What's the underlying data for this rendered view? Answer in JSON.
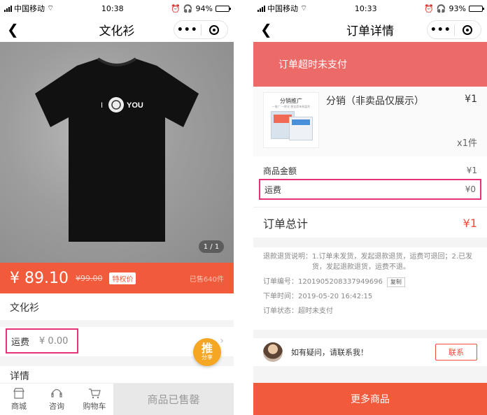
{
  "left": {
    "status": {
      "carrier": "中国移动",
      "time": "10:38",
      "battery": "94%",
      "battery_level": 0.94
    },
    "nav": {
      "title": "文化衫"
    },
    "hero": {
      "page_indicator": "1 / 1",
      "shirt_text_left": "I",
      "shirt_text_right": "YOU"
    },
    "price": {
      "current": "¥ 89.10",
      "original": "¥99.00",
      "tag": "特权价",
      "sold": "已售640件"
    },
    "name": "文化衫",
    "shipping": {
      "label": "运费",
      "value": "¥ 0.00"
    },
    "details_label": "详情",
    "promote": {
      "big": "推",
      "small": "分享"
    },
    "bottom": {
      "store": "商城",
      "consult": "咨询",
      "cart": "购物车",
      "status_button": "商品已售罄"
    }
  },
  "right": {
    "status": {
      "carrier": "中国移动",
      "time": "10:33",
      "battery": "93%",
      "battery_level": 0.93
    },
    "nav": {
      "title": "订单详情"
    },
    "alert": "订单超时未支付",
    "product": {
      "thumb_title": "分销推广",
      "thumb_subtitle": "一推广 一转化 便宜简单易盈利",
      "name": "分销（非卖品仅展示）",
      "price": "¥1",
      "qty": "x1件"
    },
    "amount": {
      "label": "商品金额",
      "value": "¥1"
    },
    "shipping": {
      "label": "运费",
      "value": "¥0"
    },
    "total": {
      "label": "订单总计",
      "value": "¥1"
    },
    "info": {
      "refund_label": "退款退货说明：",
      "refund_text": "1.订单未发货，发起退款退货，运费可退回；2.已发货，发起退款退货，运费不退。",
      "order_no": "订单编号：1201905208337949696",
      "copy": "复制",
      "order_time": "下单时间：2019-05-20 16:42:15",
      "order_status": "订单状态：超时未支付"
    },
    "contact": {
      "question": "如有疑问，请联系我！",
      "button": "联系"
    },
    "more_button": "更多商品"
  },
  "colors": {
    "accent": "#f15a3b",
    "alert": "#ec6a67",
    "highlight": "#e9317a",
    "promote": "#f5a623"
  }
}
